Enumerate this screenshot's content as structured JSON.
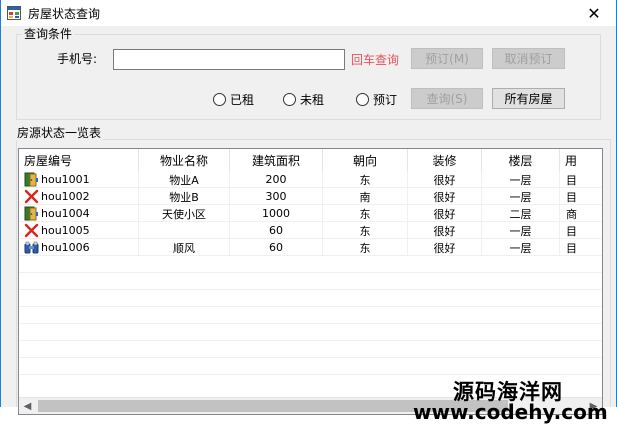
{
  "window": {
    "title": "房屋状态查询",
    "close_symbol": "✕"
  },
  "query_group": {
    "title": "查询条件",
    "phone_label": "手机号:",
    "phone_value": "",
    "phone_placeholder": "",
    "enter_hint": "回车查询",
    "reserve_button": "预订(M)",
    "cancel_reserve_button": "取消预订",
    "radios": [
      {
        "label": "已租",
        "checked": false
      },
      {
        "label": "未租",
        "checked": false
      },
      {
        "label": "预订",
        "checked": false
      }
    ],
    "query_button": "查询(S)",
    "all_houses_button": "所有房屋"
  },
  "list_group": {
    "title": "房源状态一览表",
    "columns": [
      "房屋编号",
      "物业名称",
      "建筑面积",
      "朝向",
      "装修",
      "楼层",
      "用"
    ],
    "rows": [
      {
        "icon": "door-open-icon",
        "cells": [
          "hou1001",
          "物业A",
          "200",
          "东",
          "很好",
          "一层",
          "目"
        ]
      },
      {
        "icon": "red-x-icon",
        "cells": [
          "hou1002",
          "物业B",
          "300",
          "南",
          "很好",
          "一层",
          "目"
        ]
      },
      {
        "icon": "door-open-icon",
        "cells": [
          "hou1004",
          "天使小区",
          "1000",
          "东",
          "很好",
          "二层",
          "商"
        ]
      },
      {
        "icon": "red-x-icon",
        "cells": [
          "hou1005",
          "",
          "60",
          "东",
          "很好",
          "一层",
          "目"
        ]
      },
      {
        "icon": "binoculars-icon",
        "cells": [
          "hou1006",
          "顺风",
          "60",
          "东",
          "很好",
          "一层",
          "目"
        ]
      }
    ]
  },
  "watermark": {
    "line1": "源码海洋网",
    "line2": "www.codehy.com"
  },
  "colors": {
    "hint": "#e8505b",
    "window_border": "#1883d7"
  }
}
